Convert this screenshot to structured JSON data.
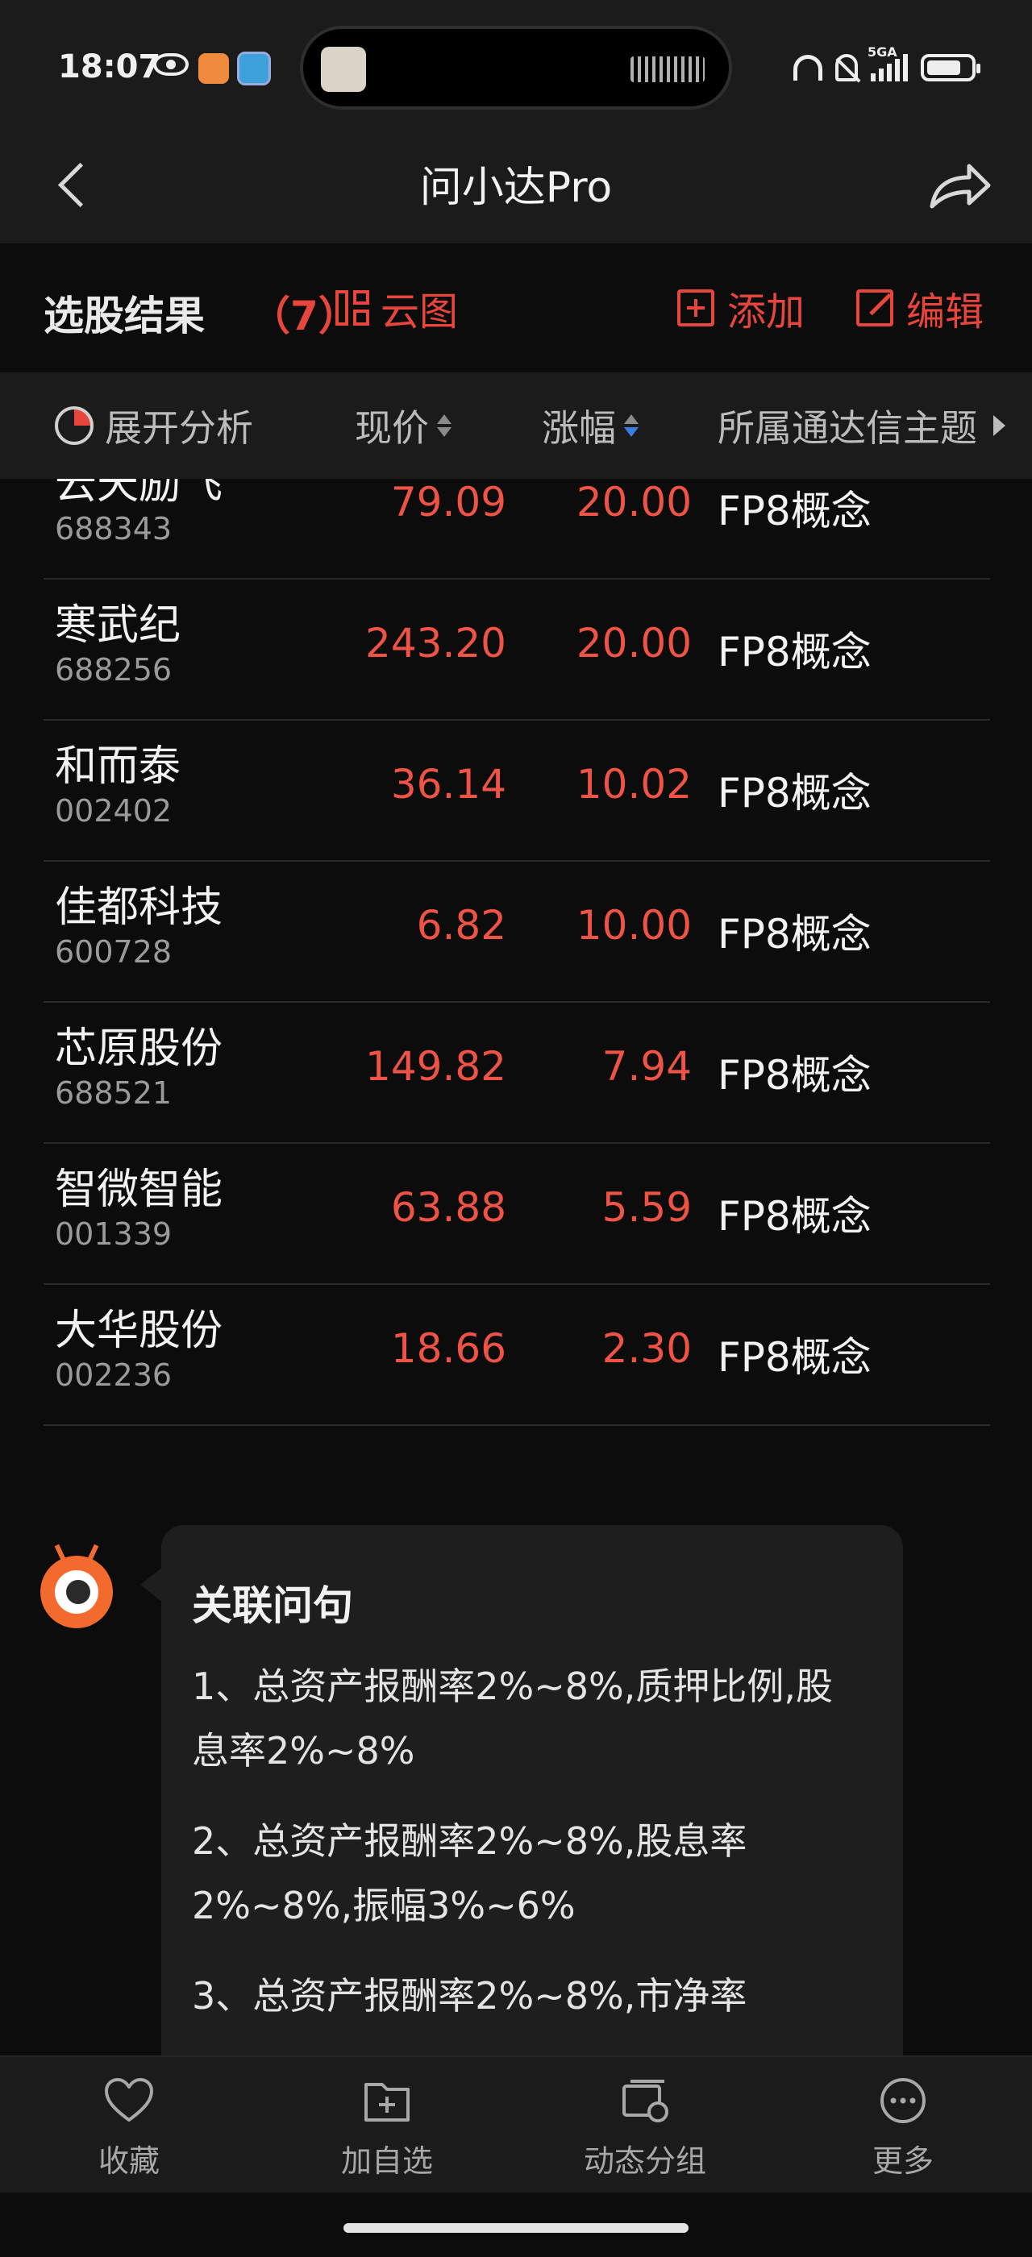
{
  "status_bar": {
    "time": "18:07",
    "network": "5GA"
  },
  "nav": {
    "title": "问小达Pro"
  },
  "results": {
    "title": "选股结果",
    "count": "（7）",
    "cloud_label": "云图",
    "add_label": "添加",
    "edit_label": "编辑"
  },
  "table": {
    "headers": {
      "analysis": "展开分析",
      "price": "现价",
      "change": "涨幅",
      "theme": "所属通达信主题"
    },
    "rows": [
      {
        "name": "云天励飞",
        "code": "688343",
        "price": "79.09",
        "change": "20.00",
        "theme": "FP8概念"
      },
      {
        "name": "寒武纪",
        "code": "688256",
        "price": "243.20",
        "change": "20.00",
        "theme": "FP8概念"
      },
      {
        "name": "和而泰",
        "code": "002402",
        "price": "36.14",
        "change": "10.02",
        "theme": "FP8概念"
      },
      {
        "name": "佳都科技",
        "code": "600728",
        "price": "6.82",
        "change": "10.00",
        "theme": "FP8概念"
      },
      {
        "name": "芯原股份",
        "code": "688521",
        "price": "149.82",
        "change": "7.94",
        "theme": "FP8概念"
      },
      {
        "name": "智微智能",
        "code": "001339",
        "price": "63.88",
        "change": "5.59",
        "theme": "FP8概念"
      },
      {
        "name": "大华股份",
        "code": "002236",
        "price": "18.66",
        "change": "2.30",
        "theme": "FP8概念"
      }
    ]
  },
  "related": {
    "title": "关联问句",
    "questions": [
      "1、总资产报酬率2%~8%,质押比例,股息率2%~8%",
      "2、总资产报酬率2%~8%,股息率2%~8%,振幅3%~6%",
      "3、总资产报酬率2%~8%,市净率"
    ]
  },
  "bottom_bar": {
    "tabs": [
      {
        "label": "收藏",
        "icon": "heart-icon"
      },
      {
        "label": "加自选",
        "icon": "add-folder-icon"
      },
      {
        "label": "动态分组",
        "icon": "dynamic-group-icon"
      },
      {
        "label": "更多",
        "icon": "more-icon"
      }
    ]
  },
  "colors": {
    "accent": "#e8453c",
    "price_up": "#ef5346",
    "sort_active": "#3b7de0",
    "background": "#0c0c0c",
    "panel": "#1b1b1b"
  }
}
